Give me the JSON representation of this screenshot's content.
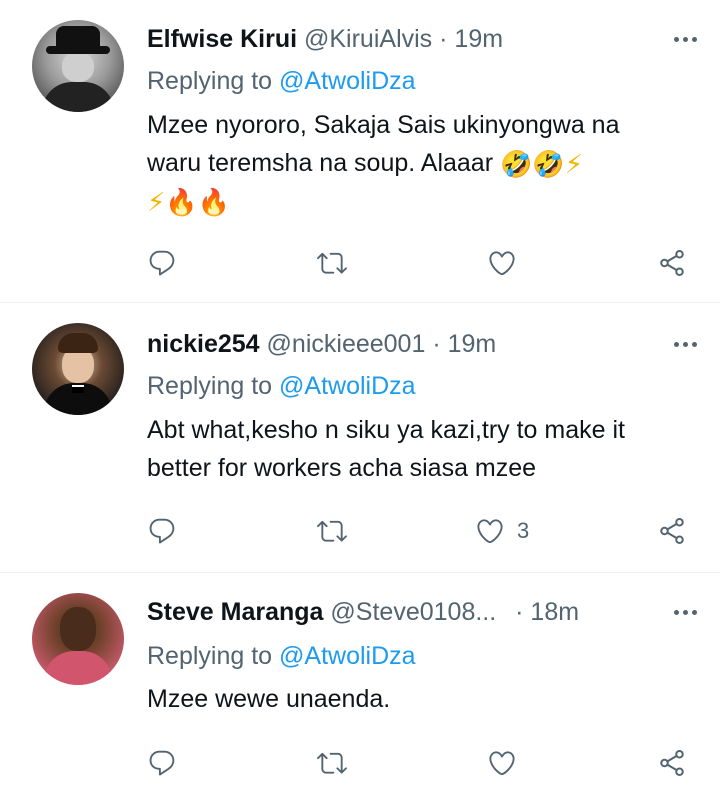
{
  "tweets": [
    {
      "name": "Elfwise Kirui",
      "handle": "@KiruiAlvis",
      "separator": "·",
      "time": "19m",
      "replying_prefix": "Replying to",
      "replying_mention": "@AtwoliDza",
      "text_line1": "Mzee nyororo, Sakaja Sais ukinyongwa na",
      "text_line2": "waru teremsha na soup. Alaaar",
      "emojis_line2": [
        "🤣",
        "🤣",
        "⚡"
      ],
      "emojis_line3": [
        "⚡",
        "🔥",
        "🔥"
      ],
      "likes": ""
    },
    {
      "name": "nickie254",
      "handle": "@nickieee001",
      "separator": "·",
      "time": "19m",
      "replying_prefix": "Replying to",
      "replying_mention": "@AtwoliDza",
      "text_line1": "Abt what,kesho n siku ya kazi,try to make it",
      "text_line2": "better for workers acha siasa mzee",
      "likes": "3"
    },
    {
      "name": "Steve Maranga",
      "handle": "@Steve0108...",
      "separator": "·",
      "time": "18m",
      "replying_prefix": "Replying to",
      "replying_mention": "@AtwoliDza",
      "text_line1": "Mzee wewe unaenda.",
      "likes": ""
    }
  ],
  "icons": {
    "reply": "reply-icon",
    "retweet": "retweet-icon",
    "like": "heart-icon",
    "share": "share-icon",
    "more": "more-icon"
  },
  "colors": {
    "text": "#0f1419",
    "secondary": "#536471",
    "link": "#1d9bf0",
    "divider": "#eff3f4"
  }
}
